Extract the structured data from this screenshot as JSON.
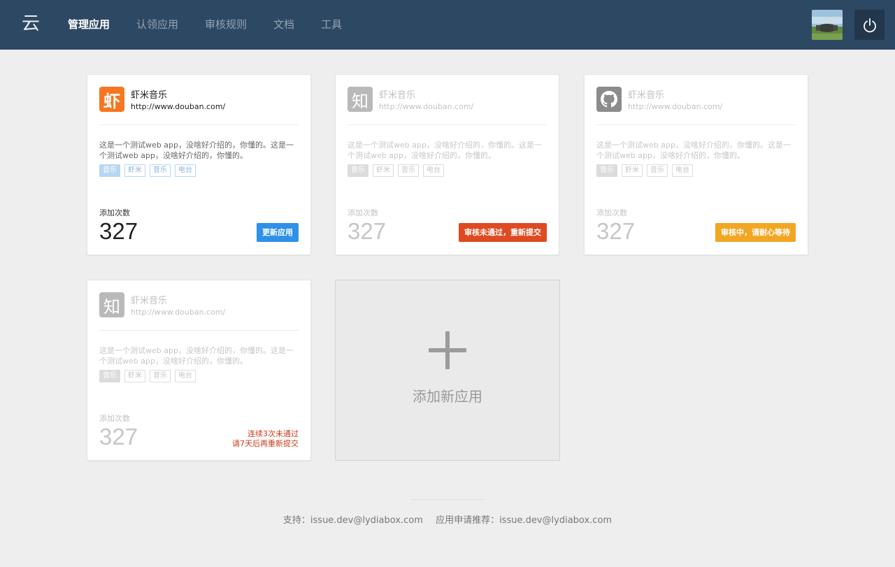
{
  "header": {
    "logo_glyph": "云",
    "nav": [
      "管理应用",
      "认领应用",
      "审核规则",
      "文档",
      "工具"
    ],
    "active_index": 0,
    "avatar_icon": "user-avatar-landscape",
    "power_icon": "power-icon"
  },
  "cards": [
    {
      "icon": "xiami-icon",
      "icon_glyph": "虾",
      "name": "虾米音乐",
      "url": "http://www.douban.com/",
      "desc": "这是一个测试web app，没啥好介绍的，你懂的。这是一个测试web app，没啥好介绍的，你懂的。",
      "tags": [
        "音乐",
        "虾米",
        "音乐",
        "电台"
      ],
      "count_label": "添加次数",
      "count": "327",
      "action": "更新应用",
      "action_color": "#2f90e8"
    },
    {
      "icon": "zhihu-icon",
      "icon_glyph": "知",
      "name": "虾米音乐",
      "url": "http://www.douban.com/",
      "desc": "这是一个测试web app，没啥好介绍的，你懂的。这是一个测试web app，没啥好介绍的，你懂的。",
      "tags": [
        "音乐",
        "虾米",
        "音乐",
        "电台"
      ],
      "count_label": "添加次数",
      "count": "327",
      "action": "审核未通过，重新提交",
      "action_color": "#de4a21"
    },
    {
      "icon": "github-icon",
      "name": "虾米音乐",
      "url": "http://www.douban.com/",
      "desc": "这是一个测试web app，没啥好介绍的，你懂的。这是一个测试web app，没啥好介绍的，你懂的。",
      "tags": [
        "音乐",
        "虾米",
        "音乐",
        "电台"
      ],
      "count_label": "添加次数",
      "count": "327",
      "action": "审核中，请耐心等待",
      "action_color": "#f2a623"
    },
    {
      "icon": "zhihu-icon",
      "icon_glyph": "知",
      "name": "虾米音乐",
      "url": "http://www.douban.com/",
      "desc": "这是一个测试web app，没啥好介绍的，你懂的。这是一个测试web app，没啥好介绍的，你懂的。",
      "tags": [
        "音乐",
        "虾米",
        "音乐",
        "电台"
      ],
      "count_label": "添加次数",
      "count": "327",
      "warning_line1": "连续3次未通过",
      "warning_line2": "请7天后再重新提交"
    }
  ],
  "add_card": {
    "label": "添加新应用",
    "icon": "plus-icon"
  },
  "footer": {
    "support": "支持：issue.dev@lydiabox.com",
    "recommend": "应用申请推荐：issue.dev@lydiabox.com"
  },
  "colors": {
    "header_bg": "#2d4862",
    "page_bg": "#eeeeee",
    "blue": "#2f90e8",
    "red": "#de4a21",
    "yellow": "#f2a623"
  }
}
